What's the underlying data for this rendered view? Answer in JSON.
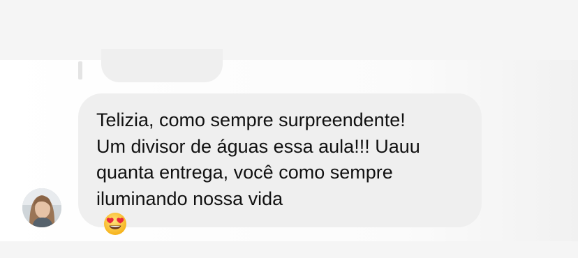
{
  "comment": {
    "lines": [
      "Telizia, como sempre surpreendente!",
      "Um divisor de águas essa aula!!! Uauu",
      "quanta entrega, você como sempre",
      "iluminando nossa vida"
    ],
    "emoji_icon": "heart-eyes-emoji-icon"
  },
  "colors": {
    "bubble": "#efefef",
    "text": "#111111",
    "band": "#f5f5f5"
  }
}
